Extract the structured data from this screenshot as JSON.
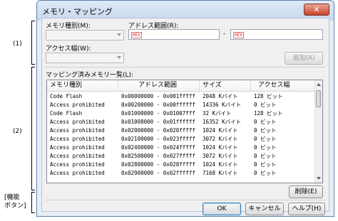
{
  "annotations": {
    "label_1": "(1)",
    "label_2": "(2)",
    "label_3": "[機能\nボタン]"
  },
  "dialog": {
    "title": "メモリ・マッピング",
    "close_glyph": "✕"
  },
  "form": {
    "memory_type_label": "メモリ種別(M):",
    "memory_type_value": "",
    "address_range_label": "アドレス範囲(R):",
    "hex_badge": "HEX",
    "range_separator": "-",
    "access_width_label": "アクセス幅(W):",
    "access_width_value": "",
    "add_button": "追加(A)"
  },
  "list": {
    "label": "マッピング済みメモリ一覧(L):",
    "columns": [
      "メモリ種別",
      "アドレス範囲",
      "サイズ",
      "アクセス幅"
    ],
    "rows": [
      [
        "Code Flash",
        "0x00000000 - 0x001fffff",
        "2048 Kバイト",
        "128 ビット"
      ],
      [
        "Access prohibited",
        "0x00200000 - 0x00ffffff",
        "14336 Kバイト",
        "0 ビット"
      ],
      [
        "Code Flash",
        "0x01000000 - 0x01007fff",
        "32 Kバイト",
        "128 ビット"
      ],
      [
        "Access prohibited",
        "0x01008000 - 0x01ffffff",
        "16352 Kバイト",
        "0 ビット"
      ],
      [
        "Access prohibited",
        "0x02000000 - 0x020fffff",
        "1024 Kバイト",
        "0 ビット"
      ],
      [
        "Access prohibited",
        "0x02100000 - 0x023fffff",
        "3072 Kバイト",
        "0 ビット"
      ],
      [
        "Access prohibited",
        "0x02400000 - 0x024fffff",
        "1024 Kバイト",
        "0 ビット"
      ],
      [
        "Access prohibited",
        "0x02500000 - 0x027fffff",
        "3072 Kバイト",
        "0 ビット"
      ],
      [
        "Access prohibited",
        "0x02800000 - 0x028fffff",
        "1024 Kバイト",
        "0 ビット"
      ],
      [
        "Access prohibited",
        "0x02900000 - 0x02ffffff",
        "7168 Kバイト",
        "0 ビット"
      ]
    ],
    "delete_button": "削除(E)"
  },
  "footer": {
    "ok_button": "OK",
    "cancel_button": "キャンセル",
    "help_button": "ヘルプ(H)"
  }
}
